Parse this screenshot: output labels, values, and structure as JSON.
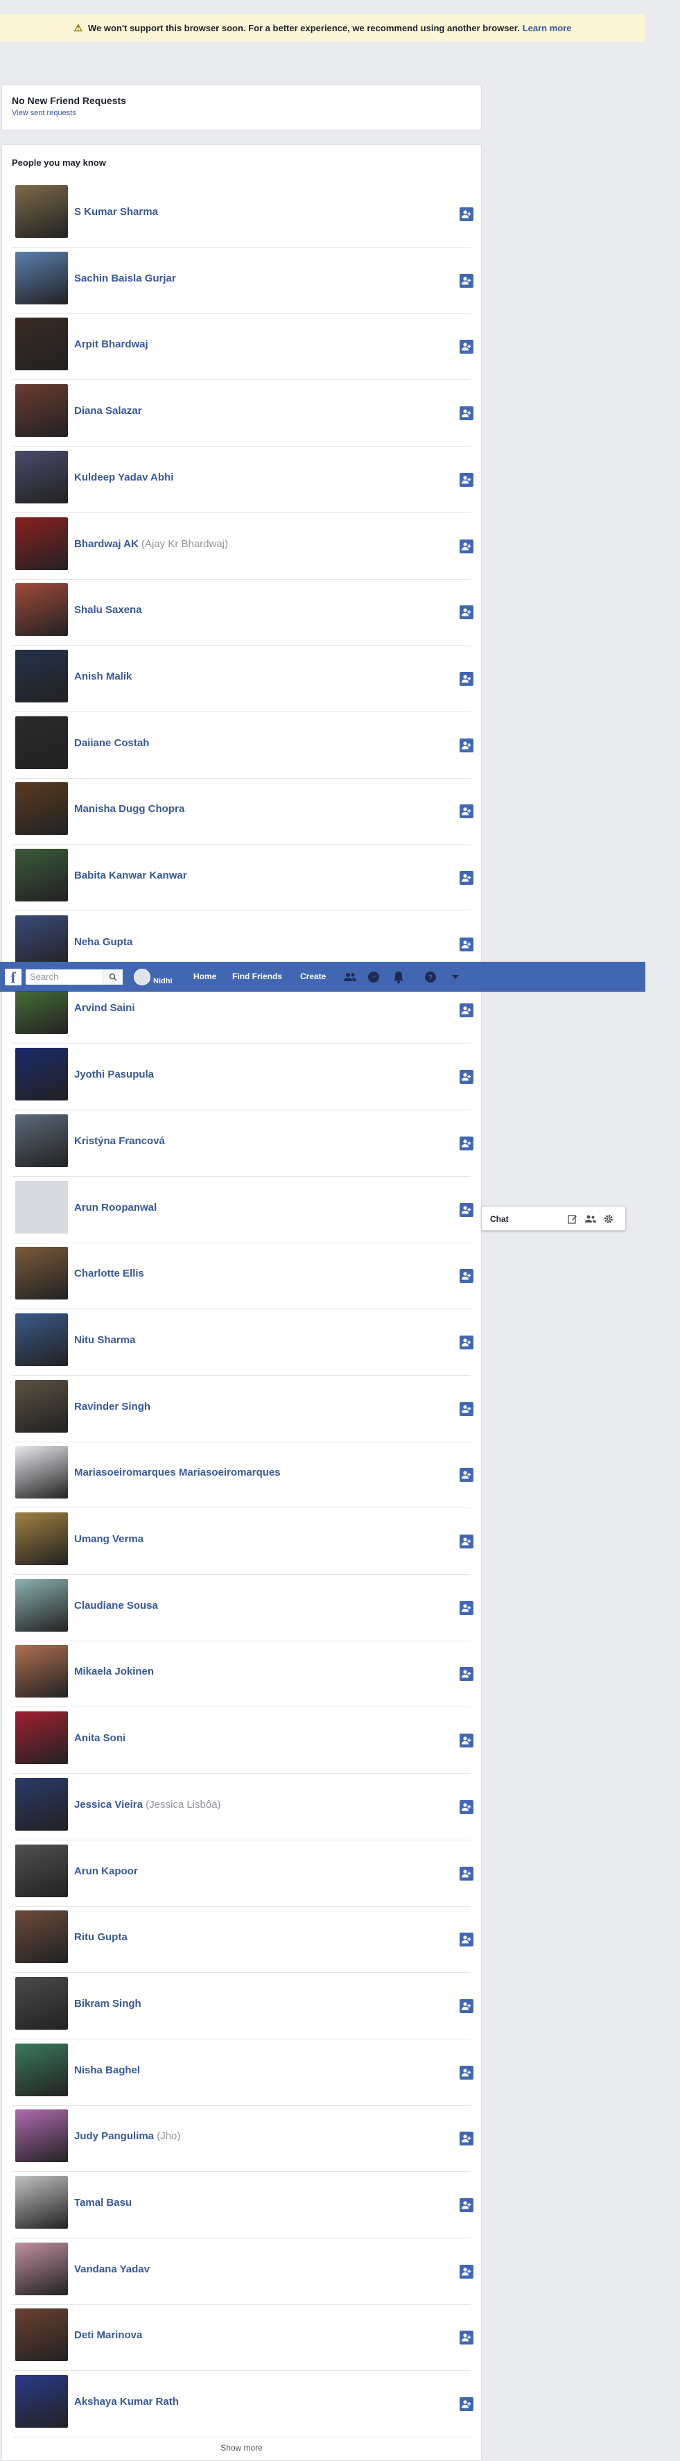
{
  "banner": {
    "text": "We won't support this browser soon. For a better experience, we recommend using another browser.",
    "link": "Learn more"
  },
  "requests": {
    "title": "No New Friend Requests",
    "link": "View sent requests"
  },
  "pymk": {
    "heading": "People you may know",
    "show_more": "Show more",
    "people": [
      {
        "name": "S Kumar Sharma",
        "alt": "",
        "color": "#7c6a4a"
      },
      {
        "name": "Sachin Baisla Gurjar",
        "alt": "",
        "color": "#5b7fb0"
      },
      {
        "name": "Arpit Bhardwaj",
        "alt": "",
        "color": "#3a2a22"
      },
      {
        "name": "Diana Salazar",
        "alt": "",
        "color": "#6b3b30"
      },
      {
        "name": "Kuldeep Yadav Abhi",
        "alt": "",
        "color": "#4a4a6a"
      },
      {
        "name": "Bhardwaj AK",
        "alt": "(Ajay Kr Bhardwaj)",
        "color": "#8a2020"
      },
      {
        "name": "Shalu Saxena",
        "alt": "",
        "color": "#a04a3a"
      },
      {
        "name": "Anish Malik",
        "alt": "",
        "color": "#23324a"
      },
      {
        "name": "Daiiane Costah",
        "alt": "",
        "color": "#2a2a2a"
      },
      {
        "name": "Manisha Dugg Chopra",
        "alt": "",
        "color": "#5a3a20"
      },
      {
        "name": "Babita Kanwar Kanwar",
        "alt": "",
        "color": "#3a5a3a"
      },
      {
        "name": "Neha Gupta",
        "alt": "",
        "color": "#3a4a7a"
      },
      {
        "name": "Arvind Saini",
        "alt": "",
        "color": "#4a7a3a"
      },
      {
        "name": "Jyothi Pasupula",
        "alt": "",
        "color": "#1a2a6a"
      },
      {
        "name": "Kristýna Francová",
        "alt": "",
        "color": "#5a6a7a"
      },
      {
        "name": "Arun Roopanwal",
        "alt": "",
        "color": "#d8dadf"
      },
      {
        "name": "Charlotte Ellis",
        "alt": "",
        "color": "#7a5a3a"
      },
      {
        "name": "Nitu Sharma",
        "alt": "",
        "color": "#3a5a8a"
      },
      {
        "name": "Ravinder Singh",
        "alt": "",
        "color": "#5a5040"
      },
      {
        "name": "Mariasoeiromarques Mariasoeiromarques",
        "alt": "",
        "color": "#e8e8ee"
      },
      {
        "name": "Umang Verma",
        "alt": "",
        "color": "#a08040"
      },
      {
        "name": "Claudiane Sousa",
        "alt": "",
        "color": "#8ab0b0"
      },
      {
        "name": "Mikaela Jokinen",
        "alt": "",
        "color": "#b07050"
      },
      {
        "name": "Anita Soni",
        "alt": "",
        "color": "#a02030"
      },
      {
        "name": "Jessica Vieira",
        "alt": "(Jessica Lisbôa)",
        "color": "#2a3a6a"
      },
      {
        "name": "Arun Kapoor",
        "alt": "",
        "color": "#505050"
      },
      {
        "name": "Ritu Gupta",
        "alt": "",
        "color": "#6a4a3a"
      },
      {
        "name": "Bikram Singh",
        "alt": "",
        "color": "#4a4a4a"
      },
      {
        "name": "Nisha Baghel",
        "alt": "",
        "color": "#3a7a5a"
      },
      {
        "name": "Judy Pangulima",
        "alt": "(Jho)",
        "color": "#b06ab0"
      },
      {
        "name": "Tamal Basu",
        "alt": "",
        "color": "#c0c0c0"
      },
      {
        "name": "Vandana Yadav",
        "alt": "",
        "color": "#c090a0"
      },
      {
        "name": "Deti Marinova",
        "alt": "",
        "color": "#6a4030"
      },
      {
        "name": "Akshaya Kumar Rath",
        "alt": "",
        "color": "#2a3a8a"
      }
    ]
  },
  "topbar": {
    "search_placeholder": "Search",
    "profile_name": "Nidhi",
    "home": "Home",
    "find_friends": "Find Friends",
    "create": "Create"
  },
  "chat": {
    "title": "Chat"
  }
}
